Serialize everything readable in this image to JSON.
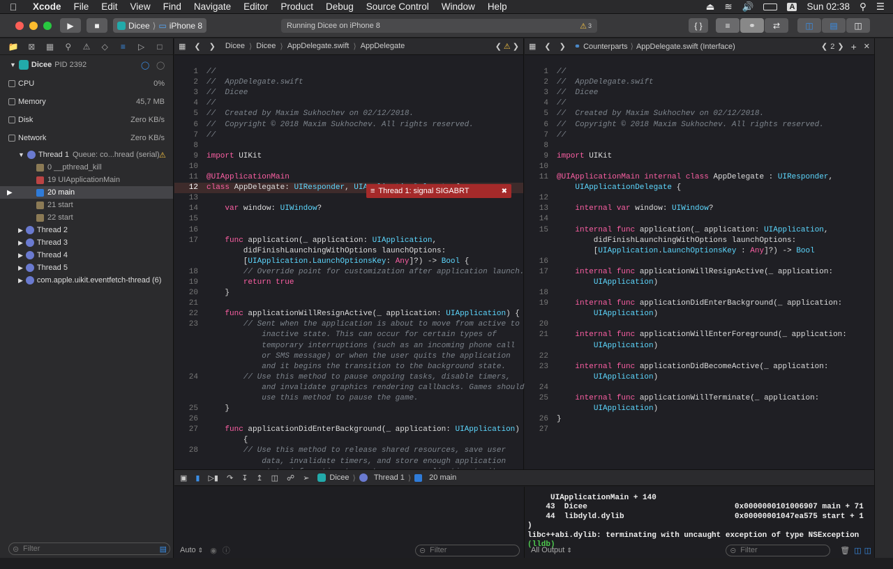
{
  "menubar": {
    "app": "Xcode",
    "items": [
      "File",
      "Edit",
      "View",
      "Find",
      "Navigate",
      "Editor",
      "Product",
      "Debug",
      "Source Control",
      "Window",
      "Help"
    ],
    "clock": "Sun 02:38",
    "input_source": "A"
  },
  "toolbar": {
    "scheme": "Dicee",
    "destination": "iPhone 8",
    "status": "Running Dicee on iPhone 8",
    "warning_count": "3"
  },
  "navigator": {
    "process": "Dicee",
    "pid": "PID 2392",
    "gauges": [
      {
        "label": "CPU",
        "value": "0%"
      },
      {
        "label": "Memory",
        "value": "45,7 MB"
      },
      {
        "label": "Disk",
        "value": "Zero KB/s"
      },
      {
        "label": "Network",
        "value": "Zero KB/s"
      }
    ],
    "thread1": {
      "label": "Thread 1",
      "queue": "Queue: co...hread (serial)"
    },
    "frames": [
      "0 __pthread_kill",
      "19 UIApplicationMain",
      "20 main",
      "21 start",
      "22 start"
    ],
    "threads": [
      "Thread 2",
      "Thread 3",
      "Thread 4",
      "Thread 5",
      "com.apple.uikit.eventfetch-thread (6)"
    ],
    "filter_placeholder": "Filter"
  },
  "left_editor": {
    "breadcrumb": [
      "Dicee",
      "Dicee",
      "AppDelegate.swift",
      "AppDelegate"
    ],
    "error_banner": "Thread 1: signal SIGABRT"
  },
  "right_editor": {
    "breadcrumb": [
      "Counterparts",
      "AppDelegate.swift (Interface)"
    ],
    "counterpart_index": "2"
  },
  "debugbar": {
    "path": [
      "Dicee",
      "Thread 1",
      "20 main"
    ]
  },
  "variables": {
    "scope": "Auto",
    "filter_placeholder": "Filter"
  },
  "console": {
    "lines": [
      "     UIApplicationMain + 140",
      "    43  Dicee                                0x0000000101006907 main + 71",
      "    44  libdyld.dylib                        0x00000001047ea575 start + 1",
      ")",
      "libc++abi.dylib: terminating with uncaught exception of type NSException"
    ],
    "prompt": "(lldb)",
    "output_mode": "All Output",
    "filter_placeholder": "Filter"
  },
  "colors": {
    "keyword": "#fc5fa3",
    "type": "#5dd8ff",
    "comment": "#7d848c",
    "error": "#a52a2a",
    "selection": "#444448"
  }
}
